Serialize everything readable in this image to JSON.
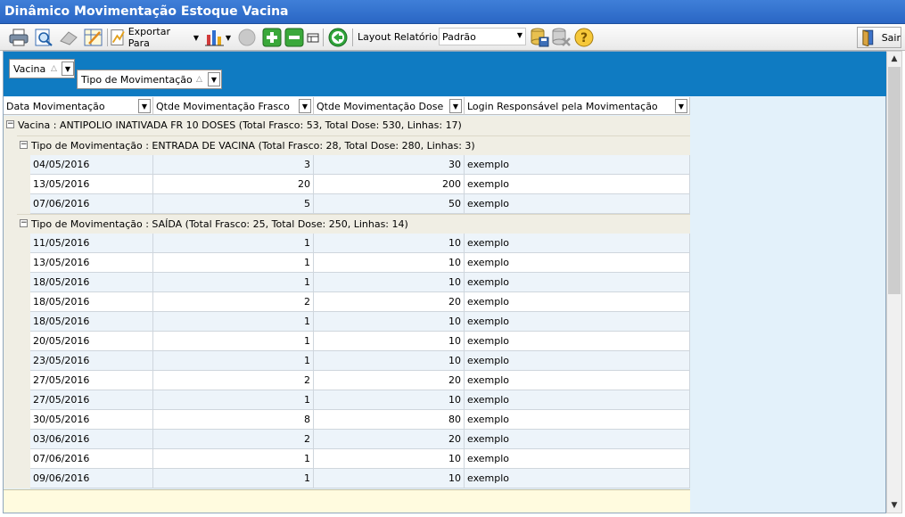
{
  "window": {
    "title": "Dinâmico Movimentação Estoque Vacina"
  },
  "toolbar": {
    "export_label": "Exportar Para",
    "layout_label": "Layout Relatório",
    "layout_value": "Padrão",
    "exit_label": "Sair"
  },
  "group_panel": {
    "group1": "Vacina",
    "group2": "Tipo de Movimentação"
  },
  "columns": [
    "Data Movimentação",
    "Qtde Movimentação Frasco",
    "Qtde Movimentação Dose",
    "Login Responsável pela Movimentação"
  ],
  "vaccine_group": {
    "label": "Vacina : ANTIPOLIO INATIVADA FR 10 DOSES (Total Frasco: 53, Total Dose: 530, Linhas: 17)"
  },
  "movement_groups": [
    {
      "label": "Tipo de Movimentação : ENTRADA DE VACINA (Total Frasco: 28, Total Dose: 280, Linhas: 3)",
      "rows": [
        {
          "date": "04/05/2016",
          "frasco": "3",
          "dose": "30",
          "login": "exemplo"
        },
        {
          "date": "13/05/2016",
          "frasco": "20",
          "dose": "200",
          "login": "exemplo"
        },
        {
          "date": "07/06/2016",
          "frasco": "5",
          "dose": "50",
          "login": "exemplo"
        }
      ]
    },
    {
      "label": "Tipo de Movimentação : SAÍDA (Total Frasco: 25, Total Dose: 250, Linhas: 14)",
      "rows": [
        {
          "date": "11/05/2016",
          "frasco": "1",
          "dose": "10",
          "login": "exemplo"
        },
        {
          "date": "13/05/2016",
          "frasco": "1",
          "dose": "10",
          "login": "exemplo"
        },
        {
          "date": "18/05/2016",
          "frasco": "1",
          "dose": "10",
          "login": "exemplo"
        },
        {
          "date": "18/05/2016",
          "frasco": "2",
          "dose": "20",
          "login": "exemplo"
        },
        {
          "date": "18/05/2016",
          "frasco": "1",
          "dose": "10",
          "login": "exemplo"
        },
        {
          "date": "20/05/2016",
          "frasco": "1",
          "dose": "10",
          "login": "exemplo"
        },
        {
          "date": "23/05/2016",
          "frasco": "1",
          "dose": "10",
          "login": "exemplo"
        },
        {
          "date": "27/05/2016",
          "frasco": "2",
          "dose": "20",
          "login": "exemplo"
        },
        {
          "date": "27/05/2016",
          "frasco": "1",
          "dose": "10",
          "login": "exemplo"
        },
        {
          "date": "30/05/2016",
          "frasco": "8",
          "dose": "80",
          "login": "exemplo"
        },
        {
          "date": "03/06/2016",
          "frasco": "2",
          "dose": "20",
          "login": "exemplo"
        },
        {
          "date": "07/06/2016",
          "frasco": "1",
          "dose": "10",
          "login": "exemplo"
        },
        {
          "date": "09/06/2016",
          "frasco": "1",
          "dose": "10",
          "login": "exemplo"
        }
      ]
    }
  ]
}
